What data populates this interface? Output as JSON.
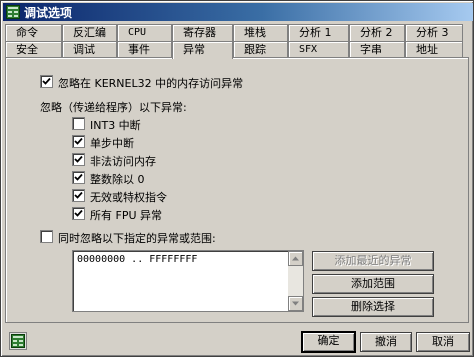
{
  "window": {
    "title": "调试选项",
    "app_icon": "debugger-app-icon"
  },
  "tabs_back": [
    "命令",
    "反汇编",
    "CPU",
    "寄存器",
    "堆栈",
    "分析 1",
    "分析 2",
    "分析 3"
  ],
  "tabs_front": [
    "安全",
    "调试",
    "事件",
    "异常",
    "跟踪",
    "SFX",
    "字串",
    "地址"
  ],
  "active_tab": "异常",
  "exceptions": {
    "ignore_kernel32": {
      "label": "忽略在 KERNEL32 中的内存访问异常",
      "checked": true
    },
    "group_label": "忽略（传递给程序）以下异常:",
    "items": [
      {
        "label": "INT3 中断",
        "checked": false
      },
      {
        "label": "单步中断",
        "checked": true
      },
      {
        "label": "非法访问内存",
        "checked": true
      },
      {
        "label": "整数除以 0",
        "checked": true
      },
      {
        "label": "无效或特权指令",
        "checked": true
      },
      {
        "label": "所有 FPU 异常",
        "checked": true
      }
    ],
    "ignore_ranges": {
      "label": "同时忽略以下指定的异常或范围:",
      "checked": false
    },
    "ranges_list": [
      "00000000 .. FFFFFFFF"
    ],
    "buttons": {
      "add_last": "添加最近的异常",
      "add_range": "添加范围",
      "delete_selection": "删除选择"
    }
  },
  "footer": {
    "ok": "确定",
    "undo": "撤消",
    "cancel": "取消"
  }
}
